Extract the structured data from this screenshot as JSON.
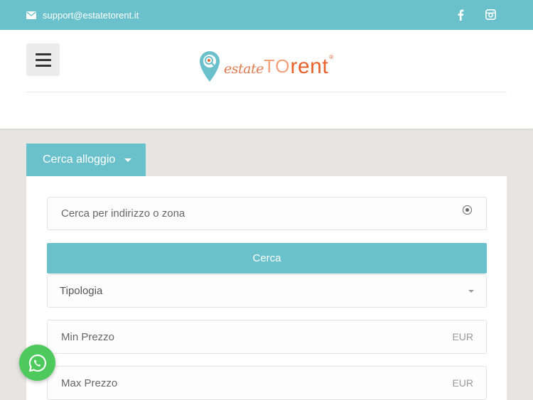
{
  "topbar": {
    "email": "support@estatetorent.it",
    "icons": [
      "envelope-icon",
      "facebook-icon",
      "instagram-icon"
    ],
    "bg_color": "#6ac1cb"
  },
  "header": {
    "logo": {
      "part1": "estate",
      "part2": "TO",
      "part3": "rent",
      "reg": "®"
    },
    "menu_icon": "hamburger-icon"
  },
  "search": {
    "tab_label": "Cerca alloggio",
    "address_placeholder": "Cerca per indirizzo o zona",
    "search_button": "Cerca",
    "tipologia_label": "Tipologia",
    "min_price_placeholder": "Min Prezzo",
    "max_price_placeholder": "Max Prezzo",
    "currency": "EUR"
  },
  "colors": {
    "accent": "#6ac1cb",
    "brand": "#e8622c",
    "whatsapp": "#4ec95b"
  }
}
